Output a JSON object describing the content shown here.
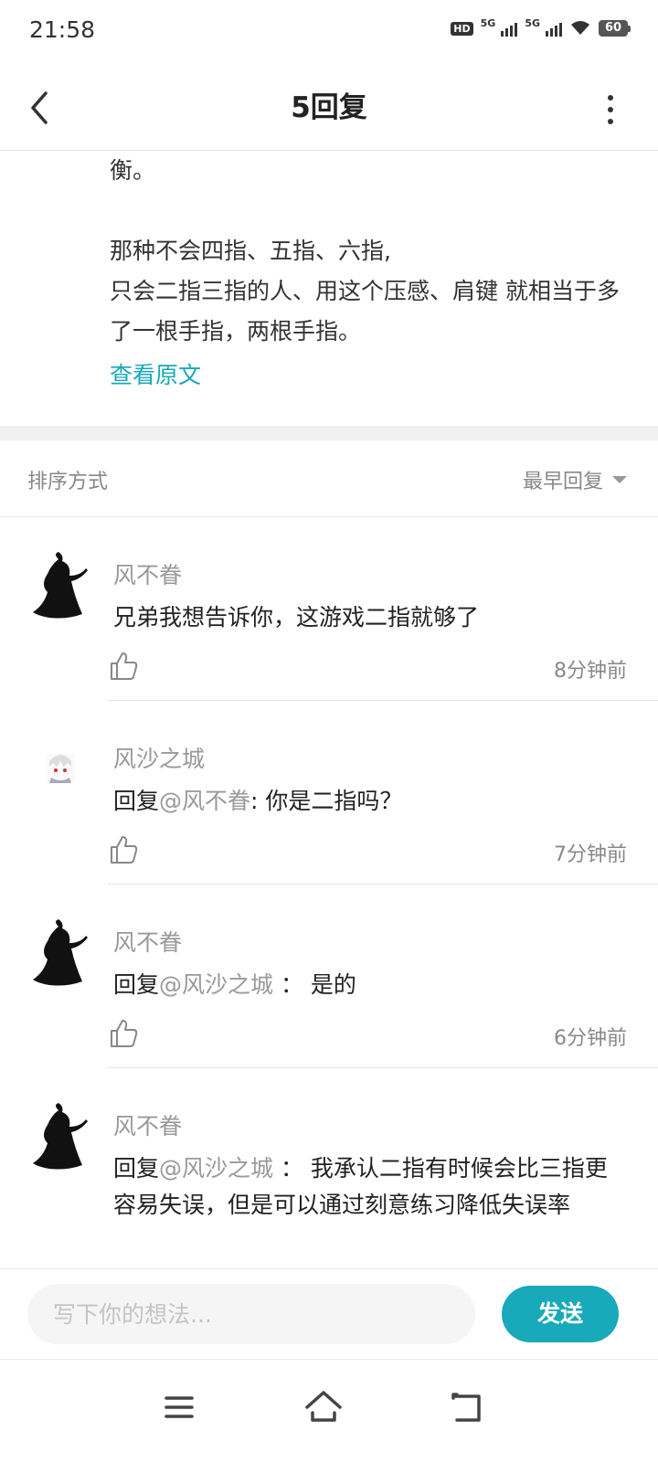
{
  "status_bar": {
    "time": "21:58",
    "hd_badge": "HD",
    "network_1": "5G",
    "network_2": "5G",
    "battery": "60"
  },
  "header": {
    "title": "5回复",
    "back_icon": "chevron-left-icon",
    "more_icon": "more-vertical-icon"
  },
  "original_post": {
    "lines": [
      "衡。",
      "",
      "那种不会四指、五指、六指,",
      "只会二指三指的人、用这个压感、肩键 就相当于多了一根手指，两根手指。"
    ],
    "view_original": "查看原文"
  },
  "sort": {
    "label": "排序方式",
    "selected": "最早回复"
  },
  "replies": [
    {
      "author": "风不眷",
      "prefix": "",
      "mention": "",
      "text": "兄弟我想告诉你，这游戏二指就够了",
      "time": "8分钟前"
    },
    {
      "author": "风沙之城",
      "prefix": "回复",
      "mention": "@风不眷",
      "text": ":  你是二指吗？",
      "time": "7分钟前"
    },
    {
      "author": "风不眷",
      "prefix": "回复",
      "mention": "@风沙之城",
      "text": " ：  是的",
      "time": "6分钟前"
    },
    {
      "author": "风不眷",
      "prefix": "回复",
      "mention": "@风沙之城",
      "text": " ：  我承认二指有时候会比三指更容易失误，但是可以通过刻意练习降低失误率",
      "time": ""
    }
  ],
  "input": {
    "placeholder": "写下你的想法...",
    "send_label": "发送"
  },
  "colors": {
    "accent": "#18a9ba",
    "link": "#17a8b8",
    "muted_text": "#999999"
  }
}
